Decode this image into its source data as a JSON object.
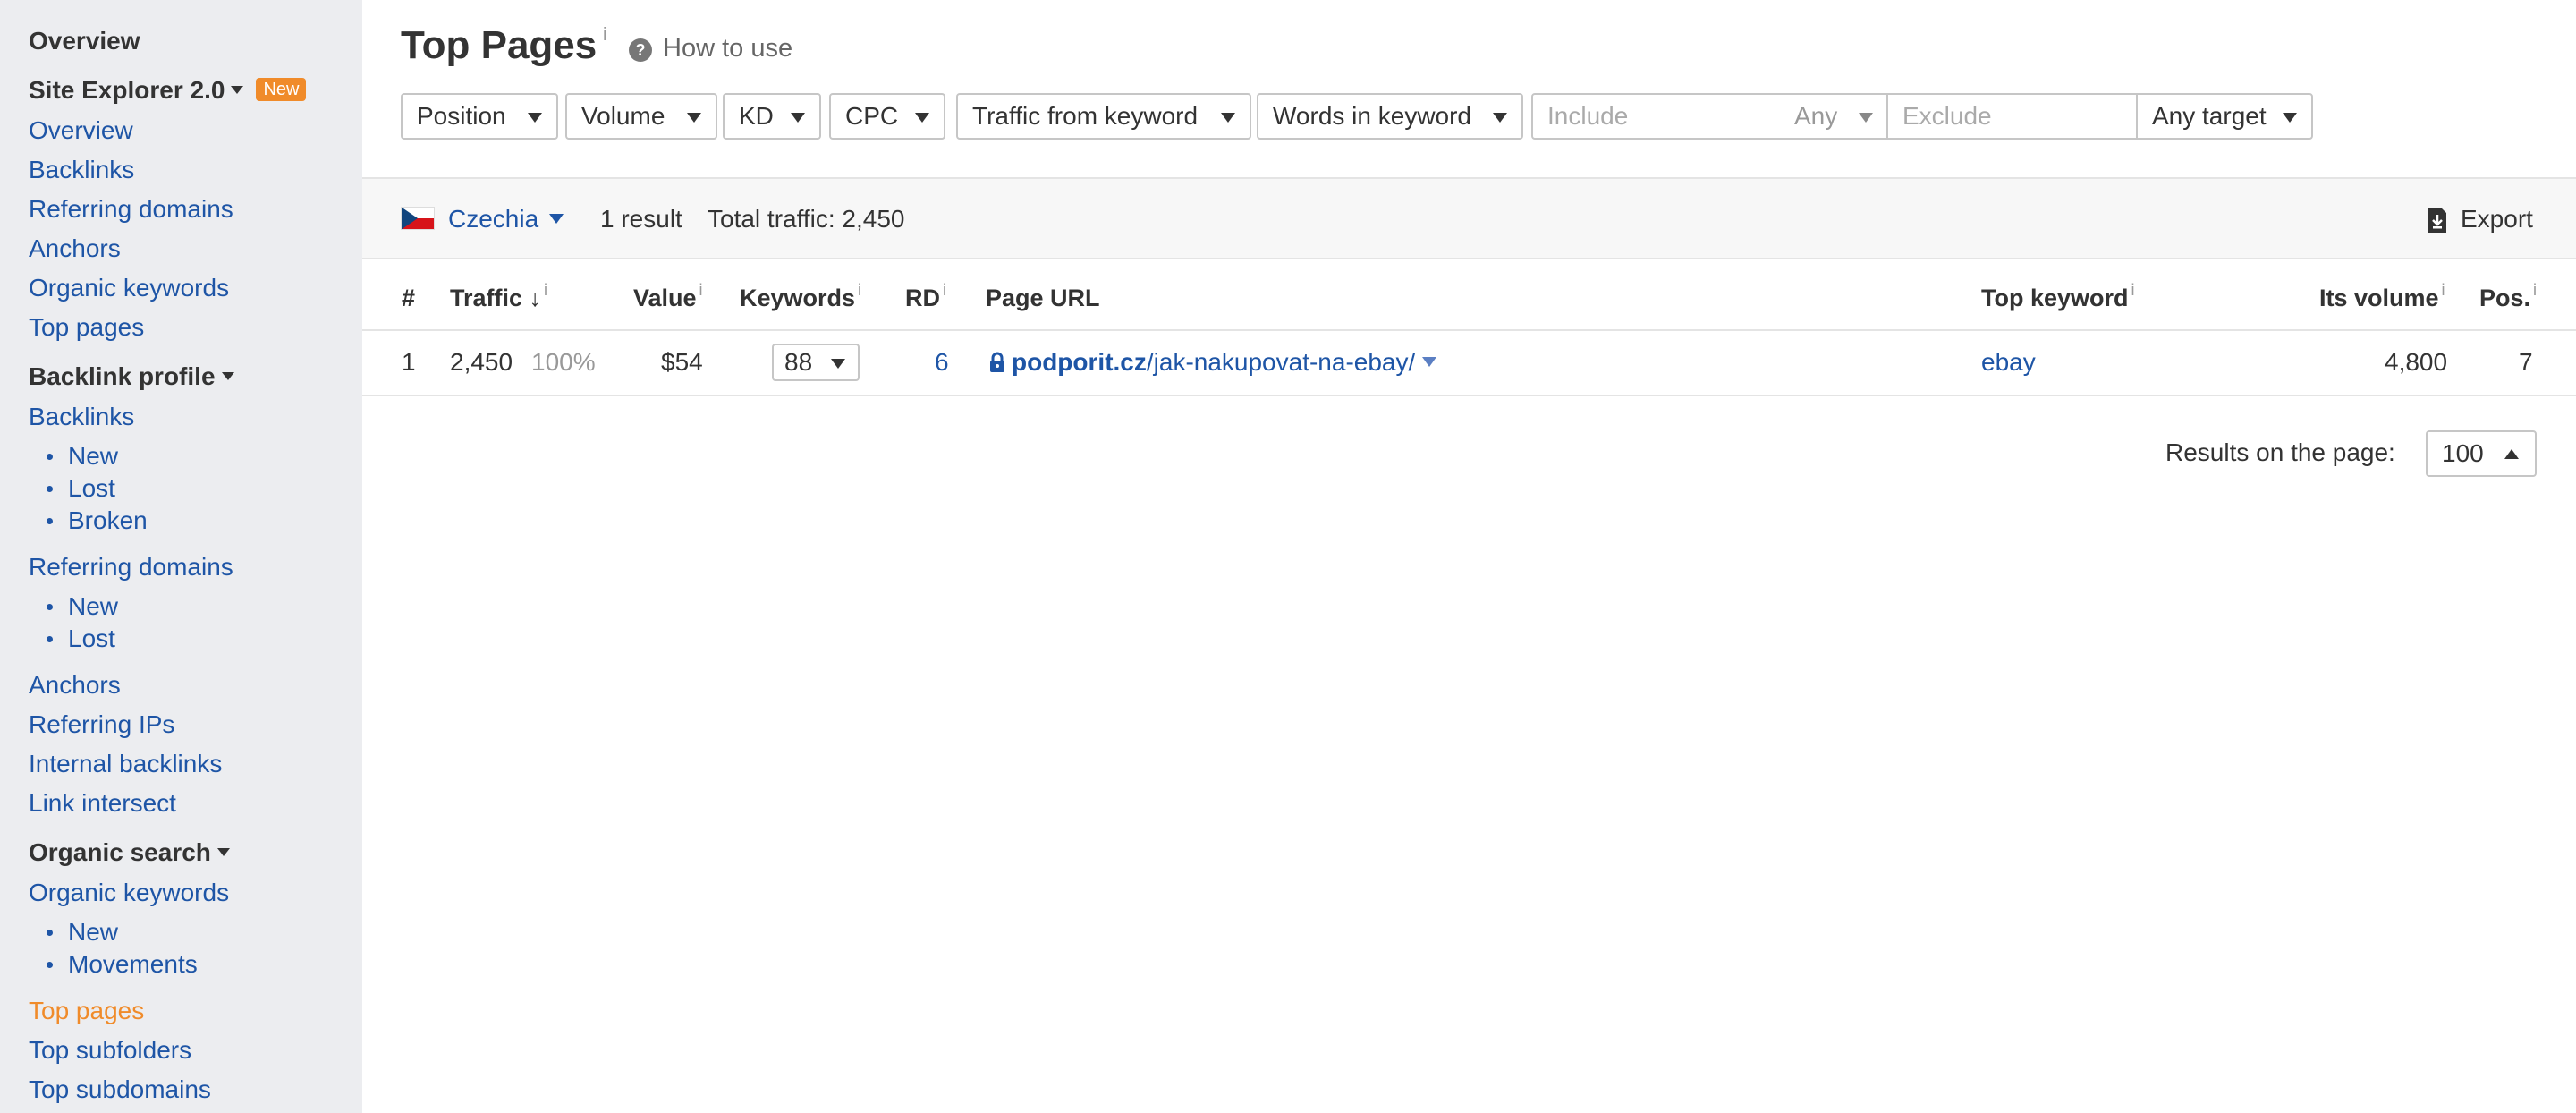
{
  "sidebar": {
    "overview_head": "Overview",
    "site_explorer": "Site Explorer 2.0",
    "new_badge": "New",
    "overview": "Overview",
    "backlinks": "Backlinks",
    "referring_domains": "Referring domains",
    "anchors": "Anchors",
    "organic_keywords": "Organic keywords",
    "top_pages": "Top pages",
    "backlink_profile": "Backlink profile",
    "bp_backlinks": "Backlinks",
    "bp_backlinks_new": "New",
    "bp_backlinks_lost": "Lost",
    "bp_backlinks_broken": "Broken",
    "bp_refdomains": "Referring domains",
    "bp_refdomains_new": "New",
    "bp_refdomains_lost": "Lost",
    "bp_anchors": "Anchors",
    "bp_ref_ips": "Referring IPs",
    "bp_internal": "Internal backlinks",
    "bp_link_intersect": "Link intersect",
    "organic_search": "Organic search",
    "os_keywords": "Organic keywords",
    "os_new": "New",
    "os_movements": "Movements",
    "os_top_pages": "Top pages",
    "os_top_subfolders": "Top subfolders",
    "os_top_subdomains": "Top subdomains"
  },
  "header": {
    "title": "Top Pages",
    "info": "i",
    "help_glyph": "?",
    "how_to_use": "How to use"
  },
  "filters": {
    "position": "Position",
    "volume": "Volume",
    "kd": "KD",
    "cpc": "CPC",
    "traffic_from_keyword": "Traffic from keyword",
    "words_in_keyword": "Words in keyword",
    "include_placeholder": "Include",
    "include_mode": "Any",
    "exclude_placeholder": "Exclude",
    "target": "Any target"
  },
  "results_bar": {
    "country": "Czechia",
    "result_count": "1 result",
    "total_traffic": "Total traffic: 2,450",
    "export": "Export"
  },
  "table": {
    "headers": {
      "index": "#",
      "traffic": "Traffic",
      "traffic_sort": "↓",
      "value": "Value",
      "keywords": "Keywords",
      "rd": "RD",
      "page_url": "Page URL",
      "top_keyword": "Top keyword",
      "its_volume": "Its volume",
      "pos": "Pos.",
      "info": "i"
    },
    "rows": [
      {
        "index": "1",
        "traffic": "2,450",
        "traffic_share": "100%",
        "value": "$54",
        "keywords": "88",
        "rd": "6",
        "url_domain": "podporit.cz",
        "url_path": "/jak-nakupovat-na-ebay/",
        "top_keyword": "ebay",
        "its_volume": "4,800",
        "pos": "7"
      }
    ]
  },
  "pagination": {
    "label": "Results on the page:",
    "per_page": "100"
  },
  "colors": {
    "link": "#1e55a6",
    "active": "#f08b2a",
    "sidebar_bg": "#ecedf0"
  }
}
